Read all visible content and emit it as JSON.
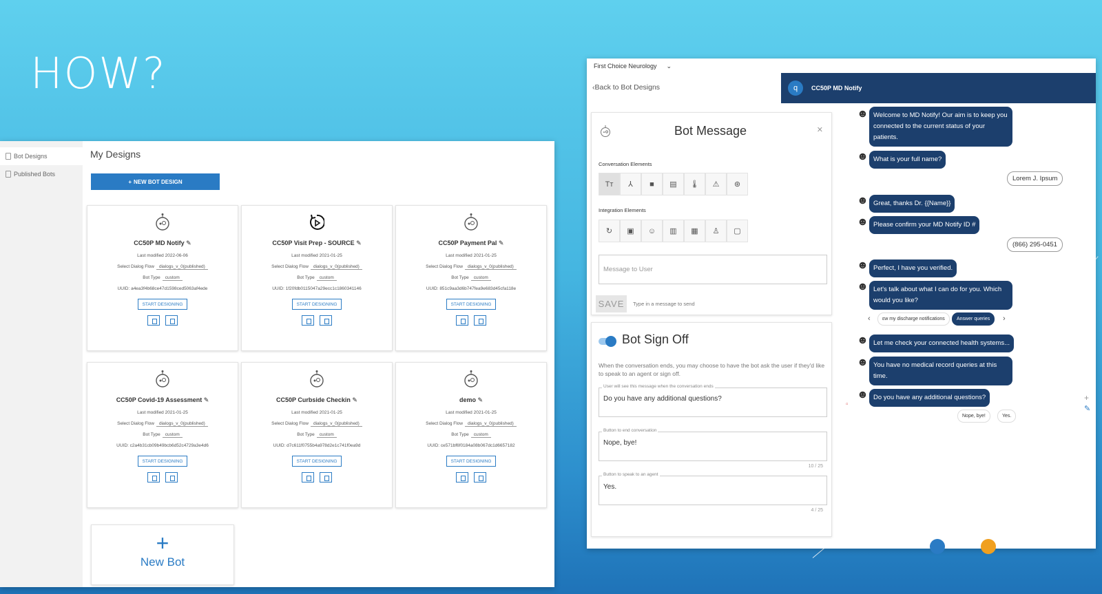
{
  "slide": {
    "title": "HOW?"
  },
  "left_panel": {
    "nav": [
      {
        "label": "Bot Designs"
      },
      {
        "label": "Published Bots"
      }
    ],
    "title": "My Designs",
    "new_design_label": "NEW BOT DESIGN",
    "cards": [
      {
        "name": "CC50P MD Notify",
        "last_modified": "Last modified 2022-06-06",
        "flow_label": "Select Dialog Flow",
        "flow": "dialogs_v_0(published)",
        "type_label": "Bot Type",
        "type": "custom",
        "uuid": "UUID: a4ea3f4b68ce47d1598ced5063af4ede",
        "start_label": "START DESIGNING"
      },
      {
        "name": "CC50P Visit Prep - SOURCE",
        "last_modified": "Last modified 2021-01-25",
        "flow_label": "Select Dialog Flow",
        "flow": "dialogs_v_0(published)",
        "type_label": "Bot Type",
        "type": "custom",
        "uuid": "UUID: 1f20fdb0115047a29ecc1c1860341146",
        "start_label": "START DESIGNING"
      },
      {
        "name": "CC50P Payment Pal",
        "last_modified": "Last modified 2021-01-25",
        "flow_label": "Select Dialog Flow",
        "flow": "dialogs_v_0(published)",
        "type_label": "Bot Type",
        "type": "custom",
        "uuid": "UUID: 851c9aa3d6b747fea9e683d45cfa118e",
        "start_label": "START DESIGNING"
      },
      {
        "name": "CC50P Covid-19 Assessment",
        "last_modified": "Last modified 2021-01-25",
        "flow_label": "Select Dialog Flow",
        "flow": "dialogs_v_0(published)",
        "type_label": "Bot Type",
        "type": "custom",
        "uuid": "UUID: c2a4b31cb09b49bcb6d52c4729a3e4d6",
        "start_label": "START DESIGNING"
      },
      {
        "name": "CC50P Curbside Checkin",
        "last_modified": "Last modified 2021-01-25",
        "flow_label": "Select Dialog Flow",
        "flow": "dialogs_v_0(published)",
        "type_label": "Bot Type",
        "type": "custom",
        "uuid": "UUID: d7c611f0755b4a978d2e1c741f0ea9d",
        "start_label": "START DESIGNING"
      },
      {
        "name": "demo",
        "last_modified": "Last modified 2021-01-25",
        "flow_label": "Select Dialog Flow",
        "flow": "dialogs_v_0(published)",
        "type_label": "Bot Type",
        "type": "custom",
        "uuid": "UUID: ce571bf6f0184a08b067dc1d6657182",
        "start_label": "START DESIGNING"
      }
    ],
    "new_bot_label": "New Bot"
  },
  "right_panel": {
    "org": "First Choice Neurology",
    "back_label": "Back to Bot Designs",
    "chat_title": "CC50P MD Notify",
    "bot_message": {
      "title": "Bot Message",
      "conv_label": "Conversation Elements",
      "integ_label": "Integration Elements",
      "placeholder": "Message to User",
      "save_label": "SAVE",
      "save_hint": "Type in a message to send"
    },
    "sign_off": {
      "title": "Bot Sign Off",
      "desc": "When the conversation ends, you may choose to have the bot ask the user if they'd like to speak to an agent or sign off.",
      "f1_label": "User will see this message when the conversation ends",
      "f1_value": "Do you have any additional questions?",
      "f2_label": "Button to end conversation",
      "f2_value": "Nope, bye!",
      "f2_count": "10 / 25",
      "f3_label": "Button to speak to an agent",
      "f3_value": "Yes.",
      "f3_count": "4 / 25"
    },
    "chat": {
      "m1": "Welcome to MD Notify! Our aim is to keep you connected to the current status of your patients.",
      "m2": "What is your full name?",
      "u1": "Lorem J. Ipsum",
      "m3": "Great, thanks Dr. {{Name}}",
      "m4": "Please confirm your MD Notify ID #",
      "u2": "(866) 295-0451",
      "m5": "Perfect, I have you verified.",
      "m6": "Let's talk about what I can do for you. Which would you like?",
      "chip1": "ɛw my discharge notifications",
      "chip2": "Answer queries",
      "m7": "Let me check your connected health systems...",
      "m8": "You have no medical record queries at this time.",
      "m9": "Do you have any additional questions?",
      "opt1": "Nope, bye!",
      "opt2": "Yes."
    }
  }
}
